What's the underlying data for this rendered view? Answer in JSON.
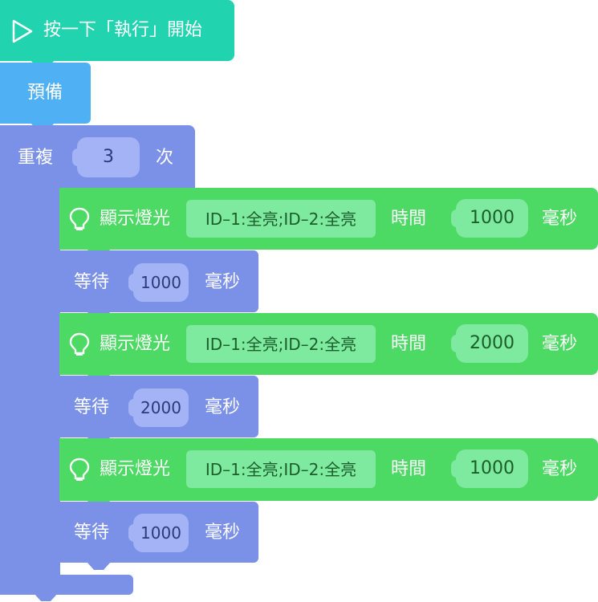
{
  "start_block": {
    "label": "按一下「執行」開始"
  },
  "prepare_block": {
    "label": "預備"
  },
  "repeat_block": {
    "label": "重複",
    "count": "3",
    "unit": "次"
  },
  "statements": [
    {
      "type": "light",
      "label": "顯示燈光",
      "value": "ID–1:全亮;ID–2:全亮",
      "time_label": "時間",
      "duration": "1000",
      "unit": "毫秒"
    },
    {
      "type": "wait",
      "label": "等待",
      "duration": "1000",
      "unit": "毫秒"
    },
    {
      "type": "light",
      "label": "顯示燈光",
      "value": "ID–1:全亮;ID–2:全亮",
      "time_label": "時間",
      "duration": "2000",
      "unit": "毫秒"
    },
    {
      "type": "wait",
      "label": "等待",
      "duration": "2000",
      "unit": "毫秒"
    },
    {
      "type": "light",
      "label": "顯示燈光",
      "value": "ID–1:全亮;ID–2:全亮",
      "time_label": "時間",
      "duration": "1000",
      "unit": "毫秒"
    },
    {
      "type": "wait",
      "label": "等待",
      "duration": "1000",
      "unit": "毫秒"
    }
  ],
  "colors": {
    "start": "#22d3b0",
    "prepare": "#4fb0f4",
    "repeat": "#7b91e8",
    "repeat_slot": "#a3b3f6",
    "light": "#4cd964",
    "light_field": "#7eeaa0",
    "wait": "#7b91e8",
    "wait_slot": "#a3b3f6"
  },
  "icons": {
    "start": "play-icon",
    "light": "lightbulb-icon"
  }
}
